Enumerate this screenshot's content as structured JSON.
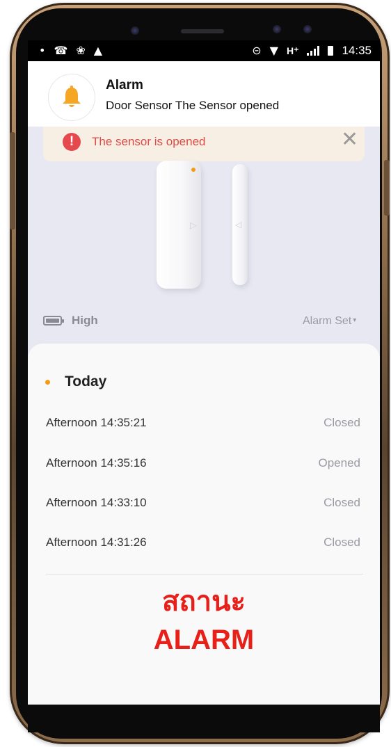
{
  "status_bar": {
    "time": "14:35",
    "network": "H⁺",
    "icons": [
      "location-pin-icon",
      "missed-call-icon",
      "aperture-icon",
      "notification-bell-icon",
      "dnd-icon",
      "wifi-icon",
      "signal-icon",
      "battery-icon"
    ]
  },
  "notification": {
    "title": "Alarm",
    "body": "Door Sensor The Sensor opened",
    "icon": "bell-icon",
    "icon_color": "#f5a623"
  },
  "banner": {
    "text": "The sensor is opened",
    "icon_text": "!",
    "close_label": "✕",
    "color": "#e04b48"
  },
  "device": {
    "battery_label": "High",
    "alarm_set_label": "Alarm Set",
    "alarm_set_caret": "▾"
  },
  "history": {
    "section_title": "Today",
    "entries": [
      {
        "time": "Afternoon  14:35:21",
        "status": "Closed"
      },
      {
        "time": "Afternoon  14:35:16",
        "status": "Opened"
      },
      {
        "time": "Afternoon  14:33:10",
        "status": "Closed"
      },
      {
        "time": "Afternoon  14:31:26",
        "status": "Closed"
      }
    ]
  },
  "overlay": {
    "line1": "สถานะ",
    "line2": "ALARM",
    "color": "#e8201a"
  },
  "colors": {
    "accent_orange": "#f39c12",
    "screen_bg": "#e8e8f3"
  }
}
